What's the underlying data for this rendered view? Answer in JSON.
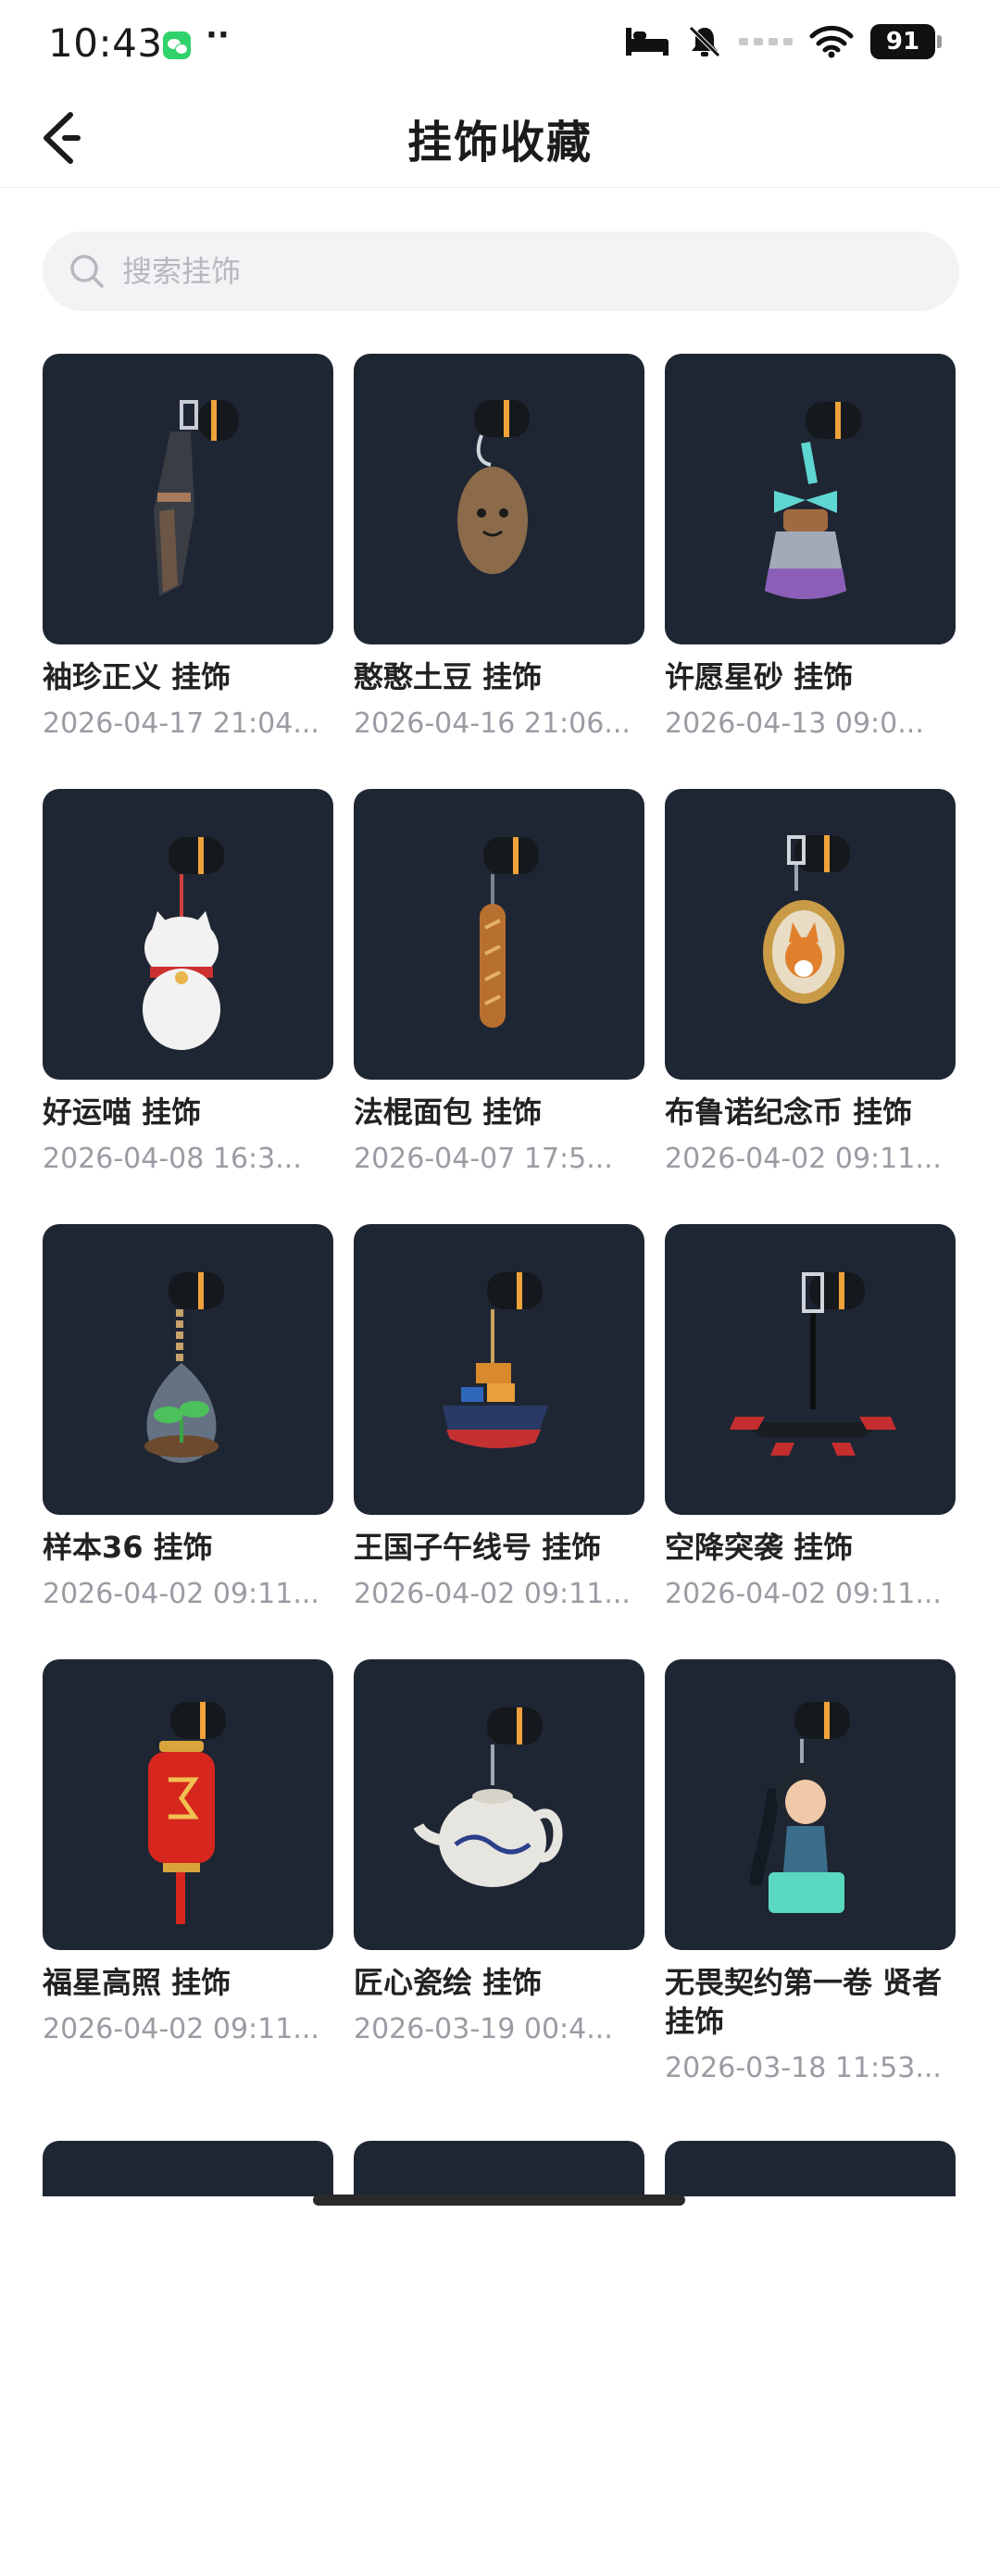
{
  "status_bar": {
    "time": "10:43",
    "battery": "91",
    "icons": [
      "wechat-notification-icon",
      "more-dots-icon",
      "bed-icon",
      "mute-icon",
      "signal-icon",
      "wifi-icon",
      "battery-icon"
    ]
  },
  "nav": {
    "back_icon": "back-arrow-icon",
    "title": "挂饰收藏"
  },
  "search": {
    "placeholder": "搜索挂饰",
    "value": ""
  },
  "items": [
    {
      "name": "袖珍正义 挂饰",
      "date": "2026-04-17 21:04...",
      "icon": "pistol-charm"
    },
    {
      "name": "憨憨土豆 挂饰",
      "date": "2026-04-16 21:06...",
      "icon": "potato-charm"
    },
    {
      "name": "许愿星砂 挂饰",
      "date": "2026-04-13 09:0...",
      "icon": "star-sand-bottle-charm"
    },
    {
      "name": "好运喵 挂饰",
      "date": "2026-04-08 16:3...",
      "icon": "lucky-cat-charm"
    },
    {
      "name": "法棍面包 挂饰",
      "date": "2026-04-07 17:5...",
      "icon": "baguette-charm"
    },
    {
      "name": "布鲁诺纪念币 挂饰",
      "date": "2026-04-02 09:11...",
      "icon": "corgi-coin-charm"
    },
    {
      "name": "样本36 挂饰",
      "date": "2026-04-02 09:11...",
      "icon": "sprout-terrarium-charm"
    },
    {
      "name": "王国子午线号 挂饰",
      "date": "2026-04-02 09:11...",
      "icon": "ship-charm"
    },
    {
      "name": "空降突袭 挂饰",
      "date": "2026-04-02 09:11...",
      "icon": "drone-charm"
    },
    {
      "name": "福星高照 挂饰",
      "date": "2026-04-02 09:11...",
      "icon": "red-lantern-charm"
    },
    {
      "name": "匠心瓷绘 挂饰",
      "date": "2026-03-19 00:4...",
      "icon": "teapot-charm"
    },
    {
      "name": "无畏契约第一卷 贤者 挂饰",
      "date": "2026-03-18 11:53...",
      "icon": "sage-figure-charm"
    }
  ],
  "colors": {
    "tile_bg": "#1f2633",
    "accent_orange": "#f0a23a",
    "date_gray": "#9a9ca3"
  }
}
